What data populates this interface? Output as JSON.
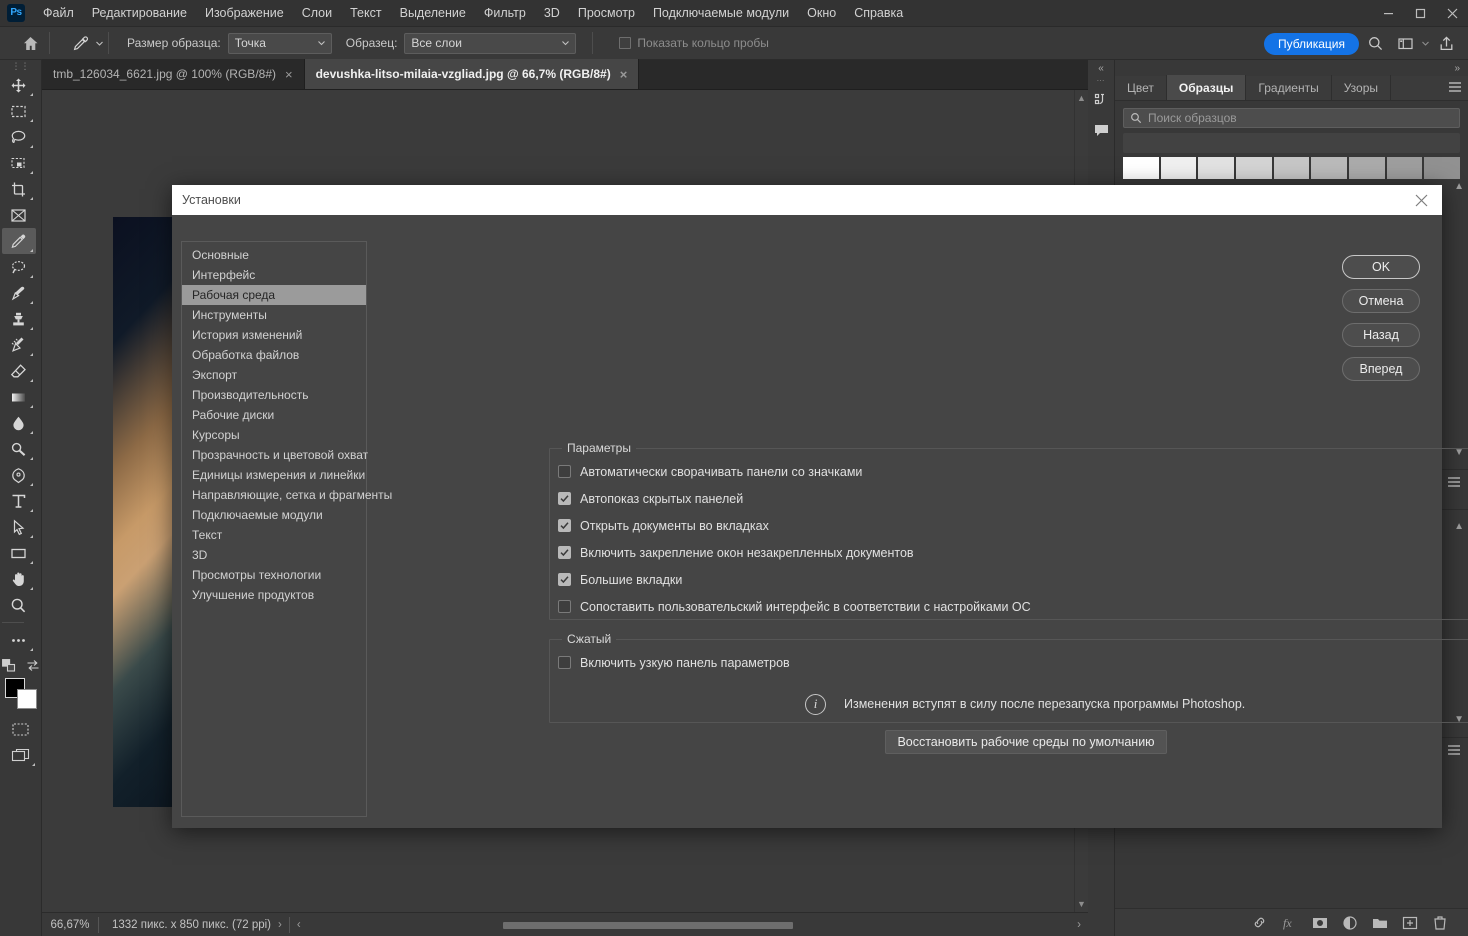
{
  "app": {
    "logo": "Ps",
    "window_controls": [
      "minimize",
      "maximize",
      "close"
    ]
  },
  "menubar": {
    "items": [
      "Файл",
      "Редактирование",
      "Изображение",
      "Слои",
      "Текст",
      "Выделение",
      "Фильтр",
      "3D",
      "Просмотр",
      "Подключаемые модули",
      "Окно",
      "Справка"
    ]
  },
  "options_bar": {
    "home_icon": "home-icon",
    "tool_icon": "eyedropper-icon",
    "sample_size_label": "Размер образца:",
    "sample_size_value": "Точка",
    "sample_label": "Образец:",
    "sample_value": "Все слои",
    "show_ring_label": "Показать кольцо пробы",
    "show_ring_checked": false,
    "publish_label": "Публикация",
    "search_icon": "search-icon",
    "workspace_icon": "workspace-icon",
    "share_icon": "share-icon"
  },
  "toolbar": {
    "tools": [
      {
        "name": "move-tool",
        "icon": "move-icon",
        "has_submenu": true,
        "active": false
      },
      {
        "name": "marquee-tool",
        "icon": "rectangular-marquee-icon",
        "has_submenu": true,
        "active": false
      },
      {
        "name": "lasso-tool",
        "icon": "lasso-icon",
        "has_submenu": true,
        "active": false
      },
      {
        "name": "quick-selection-tool",
        "icon": "object-selection-icon",
        "has_submenu": true,
        "active": false
      },
      {
        "name": "crop-tool",
        "icon": "crop-icon",
        "has_submenu": true,
        "active": false
      },
      {
        "name": "frame-tool",
        "icon": "frame-icon",
        "has_submenu": false,
        "active": false
      },
      {
        "name": "eyedropper-tool",
        "icon": "eyedropper-icon",
        "has_submenu": true,
        "active": true
      },
      {
        "name": "spot-healing-tool",
        "icon": "healing-brush-icon",
        "has_submenu": true,
        "active": false
      },
      {
        "name": "brush-tool",
        "icon": "brush-icon",
        "has_submenu": true,
        "active": false
      },
      {
        "name": "clone-stamp-tool",
        "icon": "clone-stamp-icon",
        "has_submenu": true,
        "active": false
      },
      {
        "name": "history-brush-tool",
        "icon": "history-brush-icon",
        "has_submenu": true,
        "active": false
      },
      {
        "name": "eraser-tool",
        "icon": "eraser-icon",
        "has_submenu": true,
        "active": false
      },
      {
        "name": "gradient-tool",
        "icon": "gradient-icon",
        "has_submenu": true,
        "active": false
      },
      {
        "name": "blur-tool",
        "icon": "blur-drop-icon",
        "has_submenu": true,
        "active": false
      },
      {
        "name": "dodge-tool",
        "icon": "dodge-icon",
        "has_submenu": true,
        "active": false
      },
      {
        "name": "pen-tool",
        "icon": "pen-icon",
        "has_submenu": true,
        "active": false
      },
      {
        "name": "type-tool",
        "icon": "type-icon",
        "has_submenu": true,
        "active": false
      },
      {
        "name": "path-selection-tool",
        "icon": "path-selection-arrow-icon",
        "has_submenu": true,
        "active": false
      },
      {
        "name": "shape-tool",
        "icon": "rectangle-shape-icon",
        "has_submenu": true,
        "active": false
      },
      {
        "name": "hand-tool",
        "icon": "hand-icon",
        "has_submenu": true,
        "active": false
      },
      {
        "name": "zoom-tool",
        "icon": "magnifier-icon",
        "has_submenu": false,
        "active": false
      },
      {
        "name": "edit-toolbar",
        "icon": "ellipsis-icon",
        "has_submenu": true,
        "active": false
      }
    ],
    "foreground_color": "#000000",
    "background_color": "#ffffff",
    "quick_mask_icon": "quick-mask-icon",
    "screen_mode_icon": "screen-mode-icon"
  },
  "document_tabs": [
    {
      "label": "tmb_126034_6621.jpg @ 100% (RGB/8#)",
      "active": false,
      "close": "×"
    },
    {
      "label": "devushka-litso-milaia-vzgliad.jpg @ 66,7% (RGB/8#)",
      "active": true,
      "close": "×"
    }
  ],
  "status_bar": {
    "zoom": "66,67%",
    "dimensions": "1332 пикс. x 850 пикс. (72 ppi)",
    "expand_arrow": "›",
    "collapse_arrow": "‹"
  },
  "right_panel": {
    "collapse_left_icon": "collapse-left-icon",
    "collapse_right_icon": "collapse-right-icon",
    "dock_icons": [
      "history-icon",
      "comments-icon"
    ],
    "tabs": [
      {
        "label": "Цвет",
        "active": false
      },
      {
        "label": "Образцы",
        "active": true
      },
      {
        "label": "Градиенты",
        "active": false
      },
      {
        "label": "Узоры",
        "active": false
      }
    ],
    "menu_icon": "panel-menu-icon",
    "search_icon": "search-icon",
    "search_placeholder": "Поиск образцов",
    "swatch_colors": [
      "#ffffff",
      "#f0f0f0",
      "#e2e2e2",
      "#d4d4d4",
      "#c6c6c6",
      "#bababa",
      "#ababab",
      "#9e9e9e",
      "#919191"
    ],
    "footer_icons": [
      "link-layers-icon",
      "layer-style-fx-icon",
      "layer-mask-icon",
      "adjustment-layer-icon",
      "new-group-icon",
      "new-layer-icon",
      "delete-layer-icon"
    ]
  },
  "dialog": {
    "title": "Установки",
    "close_icon": "close-icon",
    "categories": [
      {
        "label": "Основные",
        "selected": false
      },
      {
        "label": "Интерфейс",
        "selected": false
      },
      {
        "label": "Рабочая среда",
        "selected": true
      },
      {
        "label": "Инструменты",
        "selected": false
      },
      {
        "label": "История изменений",
        "selected": false
      },
      {
        "label": "Обработка файлов",
        "selected": false
      },
      {
        "label": "Экспорт",
        "selected": false
      },
      {
        "label": "Производительность",
        "selected": false
      },
      {
        "label": "Рабочие диски",
        "selected": false
      },
      {
        "label": "Курсоры",
        "selected": false
      },
      {
        "label": "Прозрачность и цветовой охват",
        "selected": false
      },
      {
        "label": "Единицы измерения и линейки",
        "selected": false
      },
      {
        "label": "Направляющие, сетка и фрагменты",
        "selected": false
      },
      {
        "label": "Подключаемые модули",
        "selected": false
      },
      {
        "label": "Текст",
        "selected": false
      },
      {
        "label": "3D",
        "selected": false
      },
      {
        "label": "Просмотры технологии",
        "selected": false
      },
      {
        "label": "Улучшение продуктов",
        "selected": false
      }
    ],
    "params_group": {
      "legend": "Параметры",
      "checkboxes": [
        {
          "label": "Автоматически сворачивать панели со значками",
          "checked": false
        },
        {
          "label": "Автопоказ скрытых панелей",
          "checked": true
        },
        {
          "label": "Открыть документы во вкладках",
          "checked": true
        },
        {
          "label": "Включить закрепление окон незакрепленных документов",
          "checked": true
        },
        {
          "label": "Большие вкладки",
          "checked": true
        },
        {
          "label": "Сопоставить пользовательский интерфейс в соответствии с настройками ОС",
          "checked": false
        }
      ]
    },
    "compact_group": {
      "legend": "Сжатый",
      "checkboxes": [
        {
          "label": "Включить узкую панель параметров",
          "checked": false
        }
      ],
      "info_icon": "info-icon",
      "info_text": "Изменения вступят в силу после перезапуска программы Photoshop."
    },
    "restore_button": "Восстановить рабочие среды по умолчанию",
    "buttons": [
      {
        "label": "OK",
        "primary": true
      },
      {
        "label": "Отмена",
        "primary": false
      },
      {
        "label": "Назад",
        "primary": false
      },
      {
        "label": "Вперед",
        "primary": false
      }
    ]
  }
}
